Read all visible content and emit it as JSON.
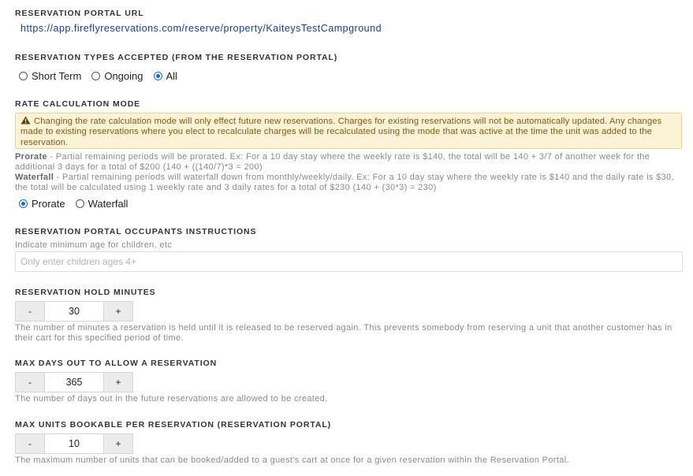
{
  "portal_url": {
    "title": "RESERVATION PORTAL URL",
    "url": "https://app.fireflyreservations.com/reserve/property/KaiteysTestCampground"
  },
  "reservation_types": {
    "title": "RESERVATION TYPES ACCEPTED (FROM THE RESERVATION PORTAL)",
    "options": [
      "Short Term",
      "Ongoing",
      "All"
    ],
    "selected": "All"
  },
  "rate_mode": {
    "title": "RATE CALCULATION MODE",
    "warning_icon": "warning-triangle-icon",
    "warning": "Changing the rate calculation mode will only effect future new reservations. Charges for existing reservations will not be automatically updated. Any changes made to existing reservations where you elect to recalculate charges will be recalculated using the mode that was active at the time the unit was added to the reservation.",
    "prorate_label": "Prorate",
    "prorate_desc": " - Partial remaining periods will be prorated. Ex: For a 10 day stay where the weekly rate is $140, the total will be 140 + 3/7 of another week for the additional 3 days for a total of $200 (140 + ((140/7)*3 = 200)",
    "waterfall_label": "Waterfall",
    "waterfall_desc": " - Partial remaining periods will waterfall down from monthly/weekly/daily. Ex: For a 10 day stay where the weekly rate is $140 and the daily rate is $30, the total will be calculated using 1 weekly rate and 3 daily rates for a total of $230 (140 + (30*3) = 230)",
    "options": [
      "Prorate",
      "Waterfall"
    ],
    "selected": "Prorate"
  },
  "occupants": {
    "title": "RESERVATION PORTAL OCCUPANTS INSTRUCTIONS",
    "hint": "Indicate minimum age for children, etc",
    "placeholder": "Only enter children ages 4+",
    "value": ""
  },
  "hold_minutes": {
    "title": "RESERVATION HOLD MINUTES",
    "minus": "-",
    "plus": "+",
    "value": "30",
    "desc": "The number of minutes a reservation is held until it is released to be reserved again. This prevents somebody from reserving a unit that another customer has in their cart for this specified period of time."
  },
  "max_days": {
    "title": "MAX DAYS OUT TO ALLOW A RESERVATION",
    "minus": "-",
    "plus": "+",
    "value": "365",
    "desc": "The number of days out in the future reservations are allowed to be created."
  },
  "max_units": {
    "title": "MAX UNITS BOOKABLE PER RESERVATION (RESERVATION PORTAL)",
    "minus": "-",
    "plus": "+",
    "value": "10",
    "desc": "The maximum number of units that can be booked/added to a guest's cart at once for a given reservation within the Reservation Portal."
  },
  "colors": {
    "accent": "#1a66d6",
    "link": "#1a3d8f",
    "warning_bg": "#fcf3d6",
    "warning_text": "#7a5a14"
  }
}
